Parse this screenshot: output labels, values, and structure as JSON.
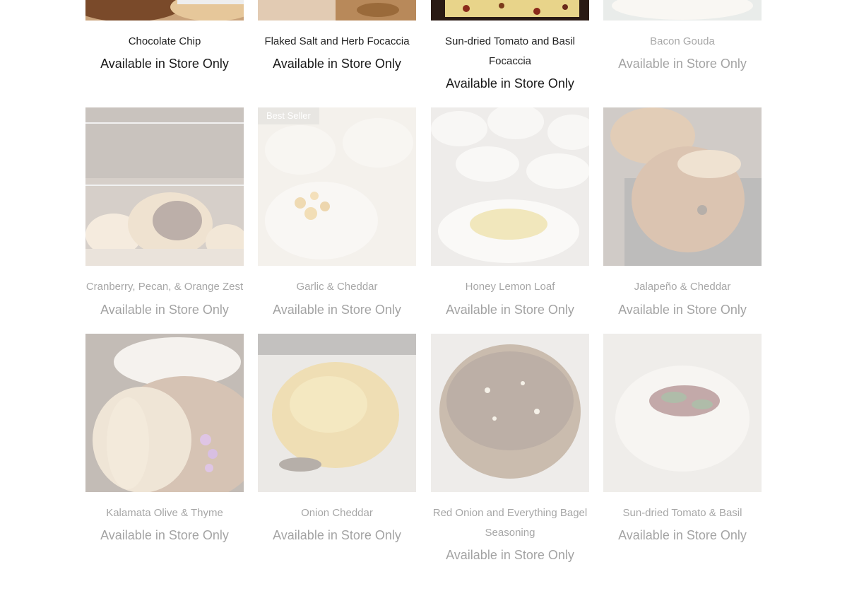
{
  "products": [
    {
      "name": "Chocolate Chip",
      "availability": "Available in Store Only",
      "image": "chocolate-chip-loaf-photo"
    },
    {
      "name": "Flaked Salt and Herb Focaccia",
      "availability": "Available in Store Only",
      "image": "focaccia-photo"
    },
    {
      "name": "Sun-dried Tomato and Basil Focaccia",
      "availability": "Available in Store Only",
      "image": "tomato-focaccia-photo"
    },
    {
      "name": "Bacon Gouda",
      "availability": "Available in Store Only",
      "image": "bacon-gouda-photo"
    },
    {
      "name": "Cranberry, Pecan, & Orange Zest",
      "availability": "Available in Store Only",
      "image": "bread-rack-photo"
    },
    {
      "name": "Garlic & Cheddar",
      "availability": "Available in Store Only",
      "image": "garlic-cheddar-dough-photo",
      "badge": "Best Seller"
    },
    {
      "name": "Honey Lemon Loaf",
      "availability": "Available in Store Only",
      "image": "honey-lemon-dough-photo"
    },
    {
      "name": "Jalapeño & Cheddar",
      "availability": "Available in Store Only",
      "image": "jalapeno-loaf-photo"
    },
    {
      "name": "Kalamata Olive & Thyme",
      "availability": "Available in Store Only",
      "image": "olive-slices-photo"
    },
    {
      "name": "Onion Cheddar",
      "availability": "Available in Store Only",
      "image": "onion-cheddar-loaf-photo"
    },
    {
      "name": "Red Onion and Everything Bagel Seasoning",
      "availability": "Available in Store Only",
      "image": "everything-bagel-loaf-photo"
    },
    {
      "name": "Sun-dried Tomato & Basil",
      "availability": "Available in Store Only",
      "image": "tomato-basil-dough-photo"
    }
  ]
}
